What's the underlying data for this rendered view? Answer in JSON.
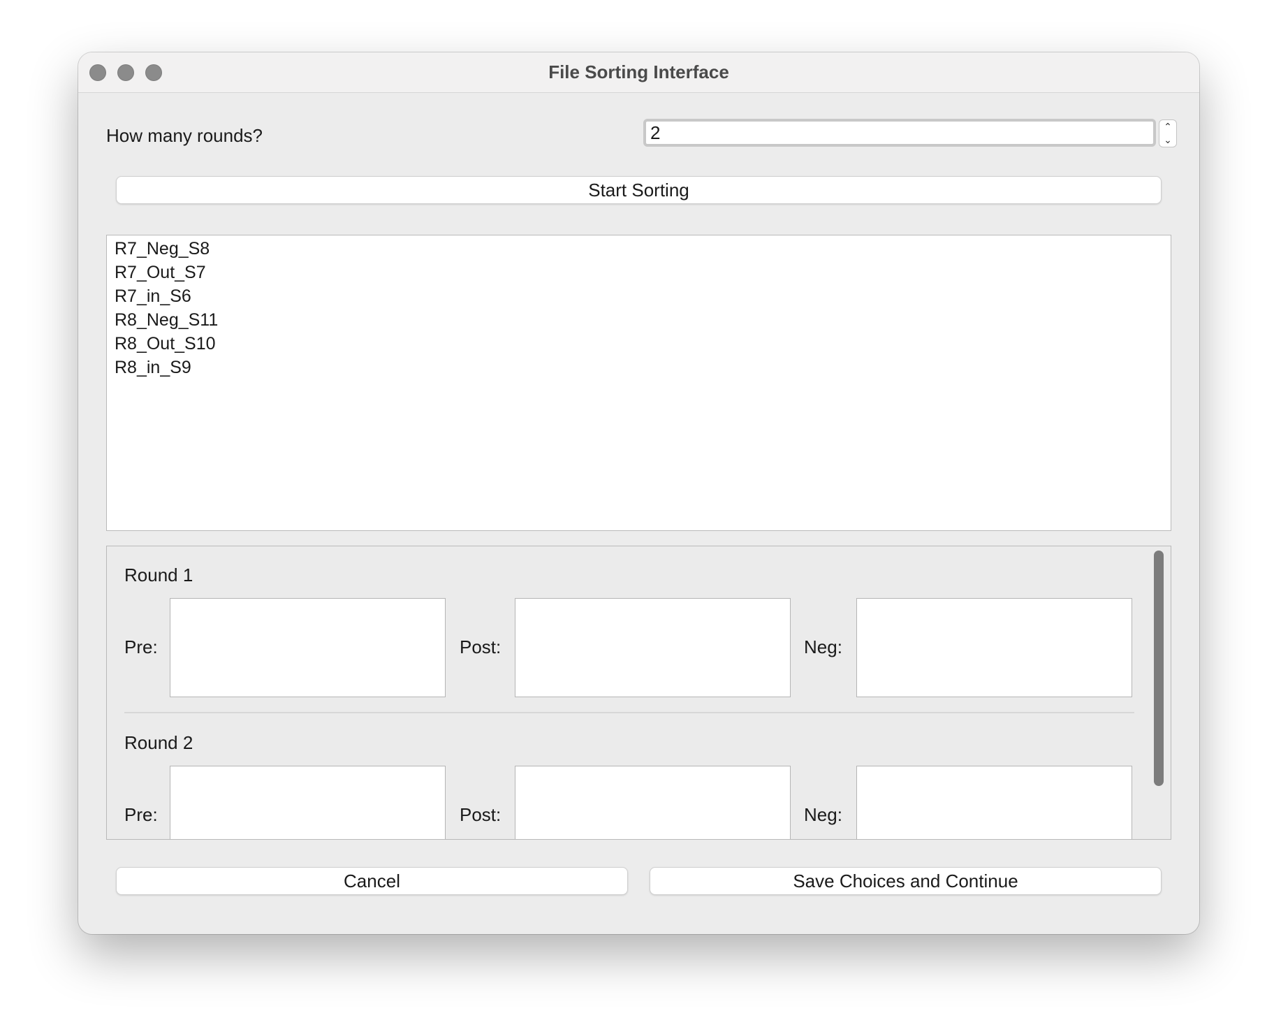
{
  "window": {
    "title": "File Sorting Interface"
  },
  "rounds_control": {
    "label": "How many rounds?",
    "value": "2",
    "up_glyph": "⌃",
    "down_glyph": "⌄"
  },
  "buttons": {
    "start_sorting": "Start Sorting",
    "cancel": "Cancel",
    "save_continue": "Save Choices and Continue"
  },
  "file_list": [
    "R7_Neg_S8",
    "R7_Out_S7",
    "R7_in_S6",
    "R8_Neg_S11",
    "R8_Out_S10",
    "R8_in_S9"
  ],
  "rounds": [
    {
      "title": "Round 1",
      "pre_label": "Pre:",
      "post_label": "Post:",
      "neg_label": "Neg:"
    },
    {
      "title": "Round 2",
      "pre_label": "Pre:",
      "post_label": "Post:",
      "neg_label": "Neg:"
    }
  ],
  "colors": {
    "window_bg": "#ececec",
    "traffic_light": "#8b8b8b",
    "scrollbar_thumb": "#7c7c7c"
  }
}
